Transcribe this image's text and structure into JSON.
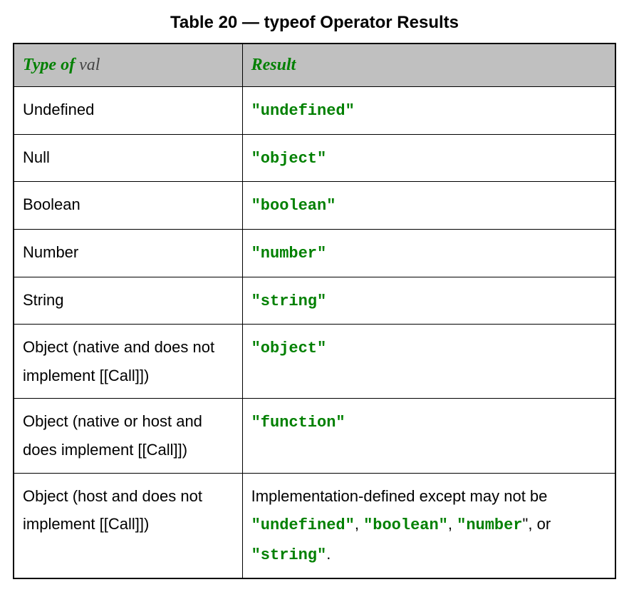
{
  "caption": "Table 20 — typeof Operator Results",
  "headers": {
    "col1_main": "Type of",
    "col1_sub": " val",
    "col2": "Result"
  },
  "rows": [
    {
      "type": "Undefined",
      "result_code": "\"undefined\""
    },
    {
      "type": "Null",
      "result_code": "\"object\""
    },
    {
      "type": "Boolean",
      "result_code": "\"boolean\""
    },
    {
      "type": "Number",
      "result_code": "\"number\""
    },
    {
      "type": "String",
      "result_code": "\"string\""
    },
    {
      "type": "Object (native and does not implement [[Call]])",
      "result_code": "\"object\""
    },
    {
      "type": "Object (native or host and does implement [[Call]])",
      "result_code": "\"function\""
    }
  ],
  "last_row": {
    "type": "Object (host and does not implement [[Call]])",
    "text_before": "Implementation-defined except may not be ",
    "codes": [
      "\"undefined\"",
      "\"boolean\"",
      "\"number",
      "\"string\""
    ],
    "sep1": ", ",
    "sep2": ", ",
    "quote_after_number": "\"",
    "sep3": ", or ",
    "period": "."
  }
}
